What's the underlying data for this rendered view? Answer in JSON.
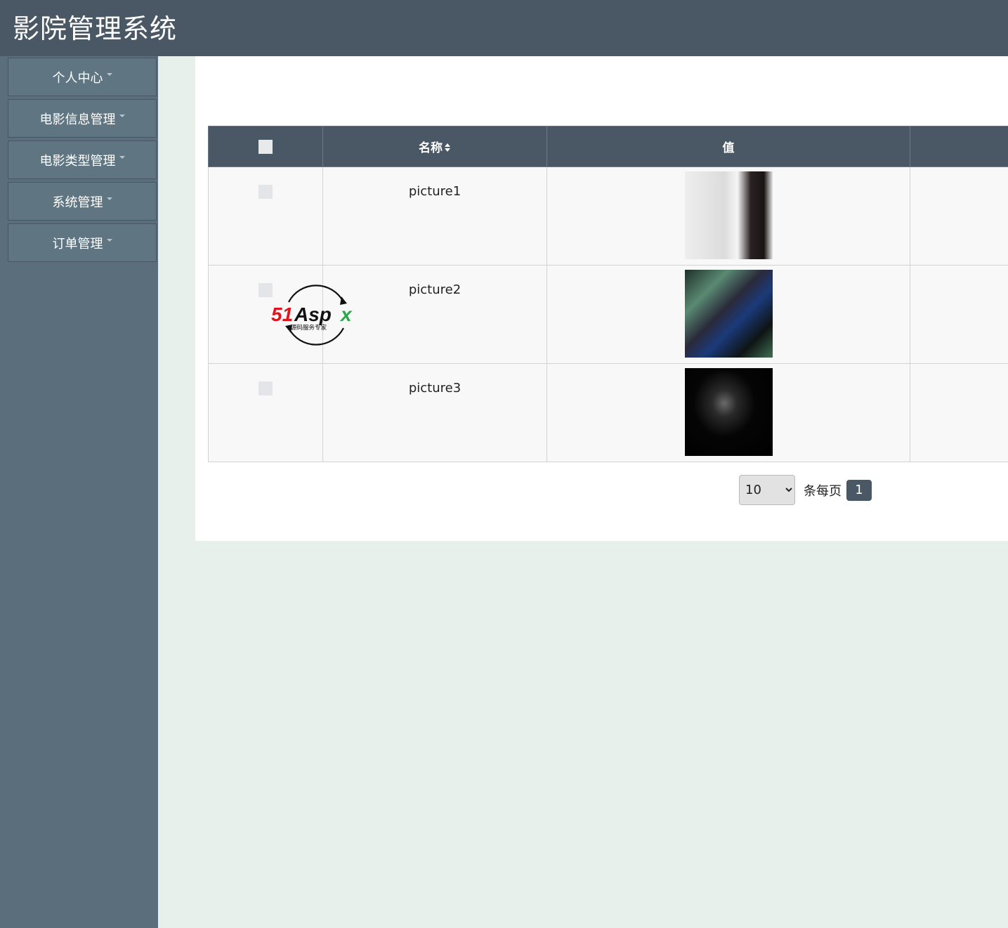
{
  "app": {
    "title": "影院管理系统"
  },
  "sidebar": {
    "items": [
      {
        "label": "个人中心"
      },
      {
        "label": "电影信息管理"
      },
      {
        "label": "电影类型管理"
      },
      {
        "label": "系统管理"
      },
      {
        "label": "订单管理"
      }
    ]
  },
  "table": {
    "columns": {
      "name": "名称",
      "value": "值"
    },
    "rows": [
      {
        "name": "picture1"
      },
      {
        "name": "picture2"
      },
      {
        "name": "picture3"
      }
    ]
  },
  "pagination": {
    "page_size": "10",
    "page_size_options": [
      "10"
    ],
    "per_page_label": "条每页",
    "current_page": "1"
  },
  "watermark": {
    "brand": "51Aspx",
    "tagline": "源码服务专家"
  }
}
